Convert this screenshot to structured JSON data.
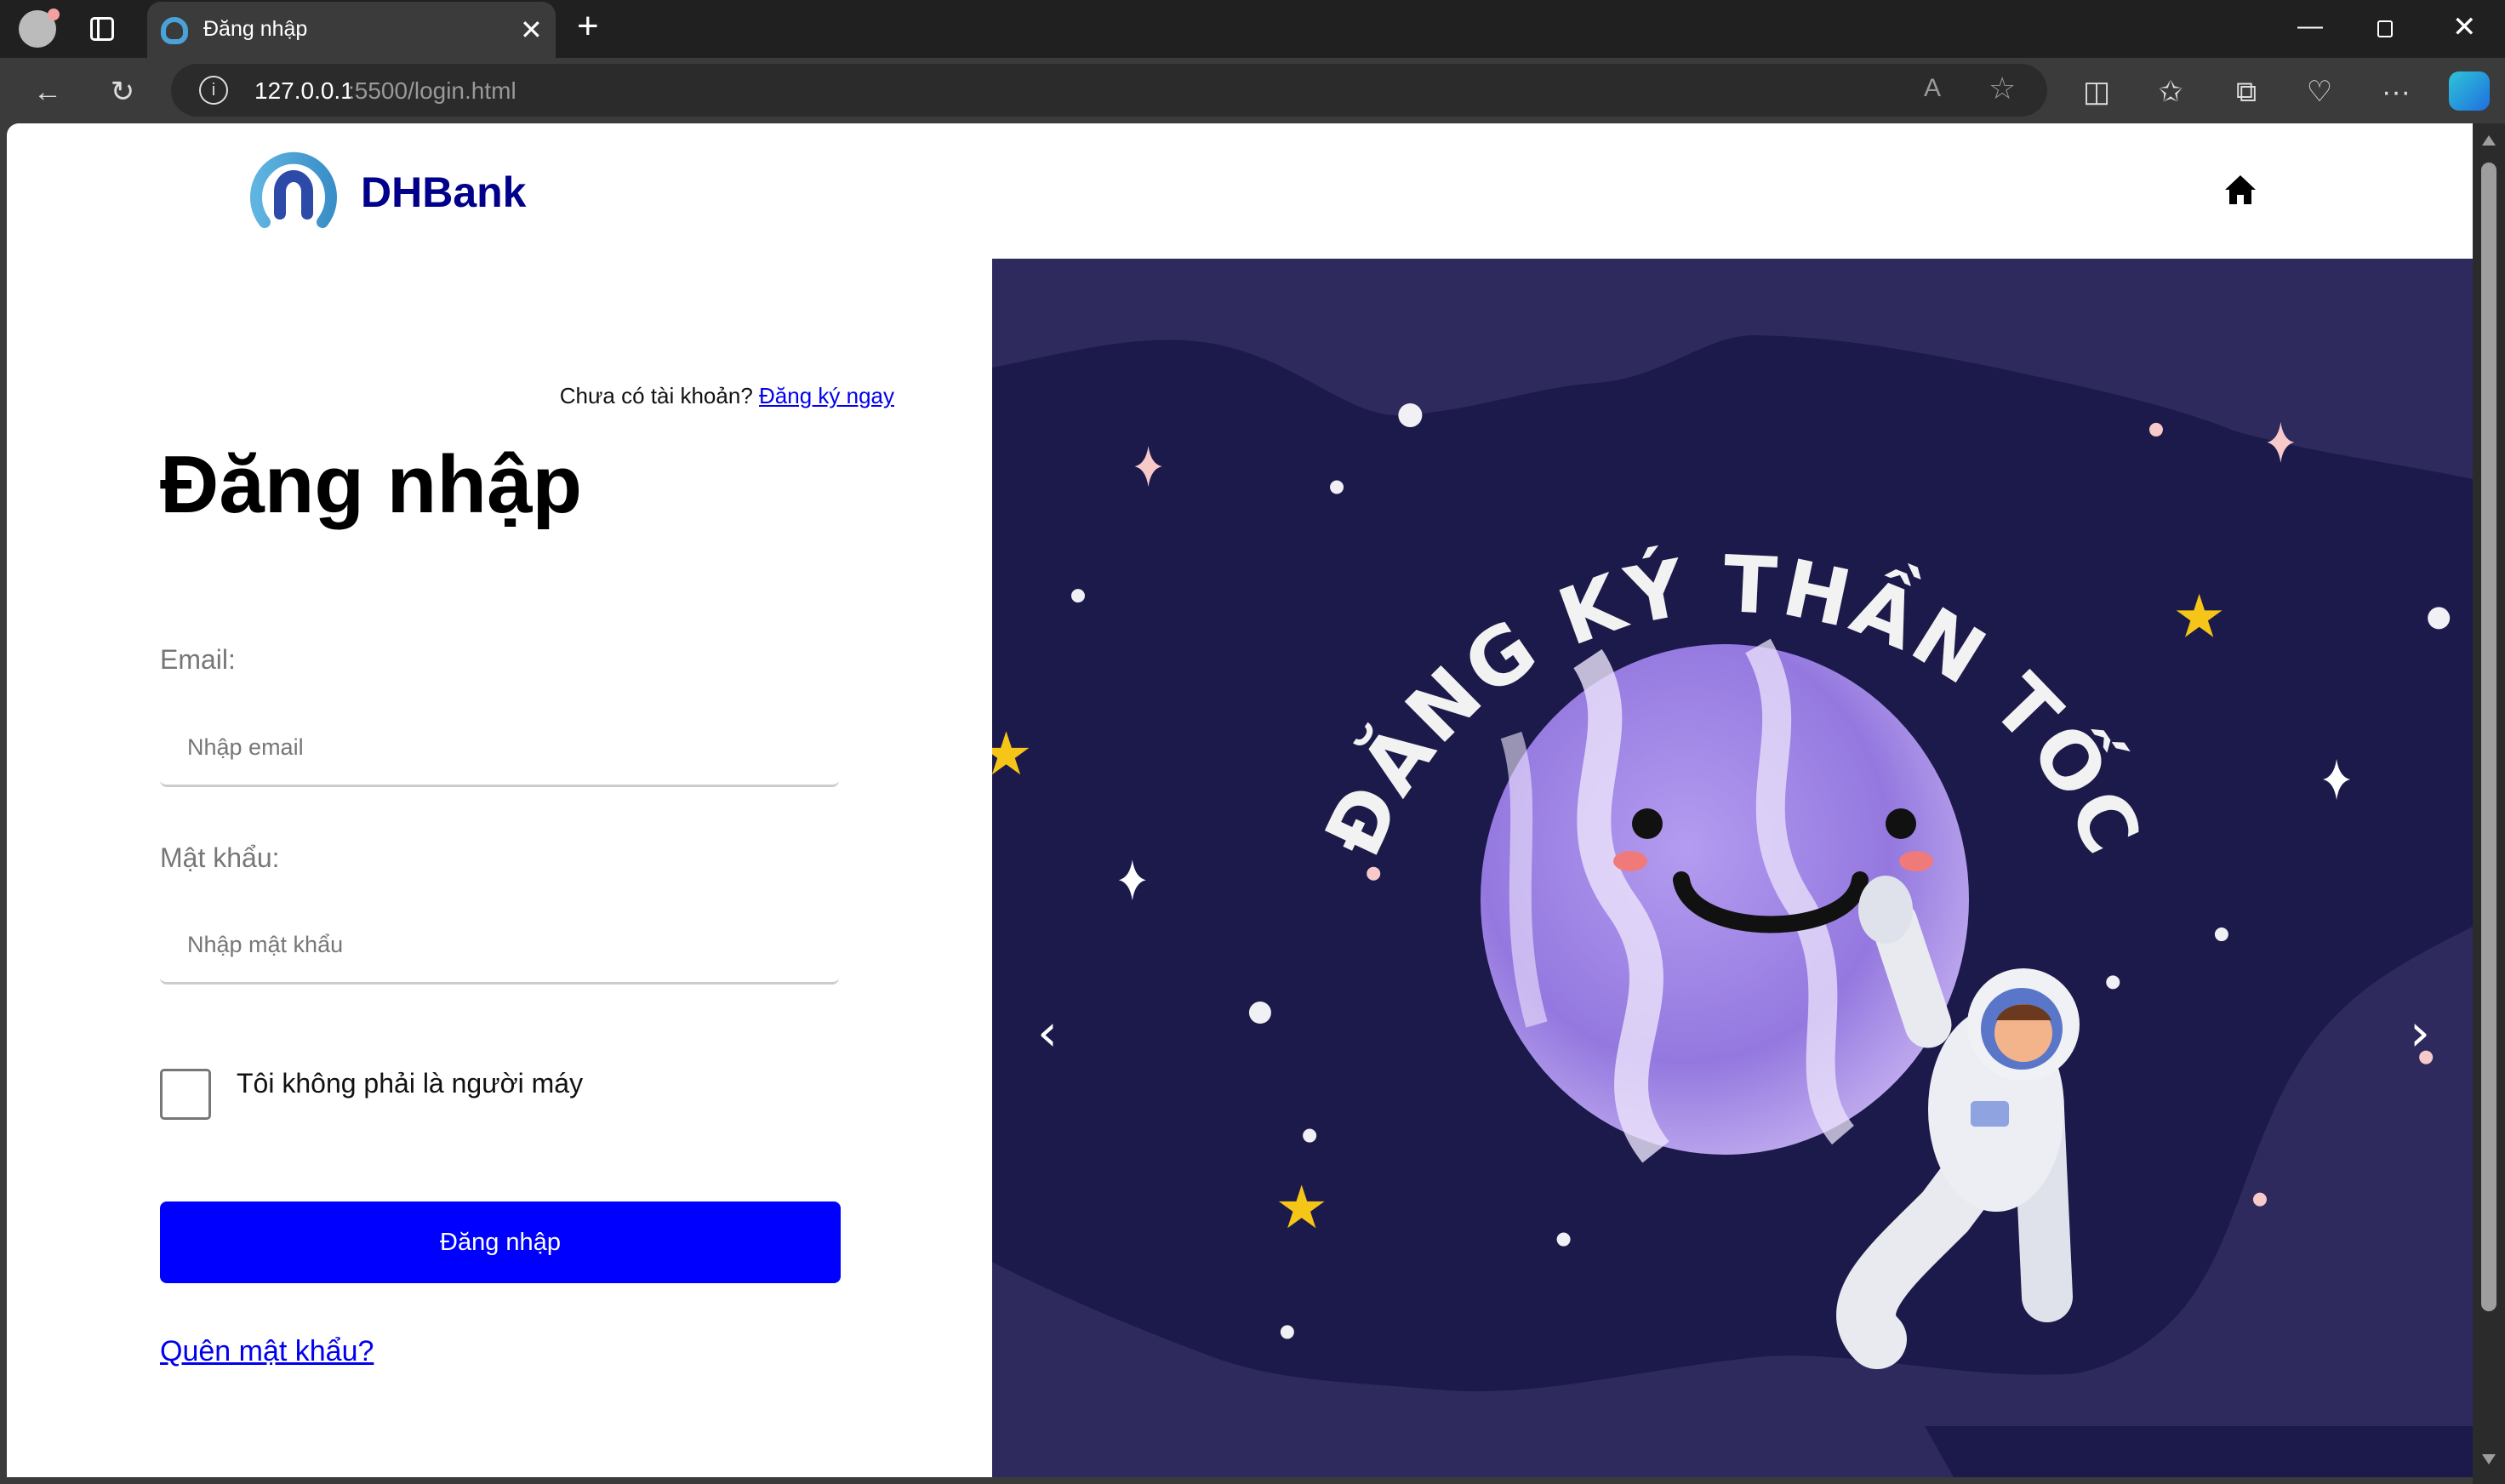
{
  "browser": {
    "tab_title": "Đăng nhập",
    "url_host": "127.0.0.1",
    "url_rest": ":5500/login.html"
  },
  "header": {
    "brand": "DHBank"
  },
  "login": {
    "signup_prompt": "Chưa có tài khoản?",
    "signup_link": "Đăng ký ngay",
    "title": "Đăng nhập",
    "email_label": "Email:",
    "email_placeholder": "Nhập email",
    "email_value": "",
    "password_label": "Mật khẩu:",
    "password_placeholder": "Nhập mật khẩu",
    "password_value": "",
    "captcha_label": "Tôi không phải là người máy",
    "captcha_checked": false,
    "submit_label": "Đăng nhập",
    "forgot_link": "Quên mật khẩu?"
  },
  "banner": {
    "headline": "ĐĂNG KÝ THẦN TỐC",
    "prev_label": "‹",
    "next_label": "›"
  },
  "colors": {
    "brand": "#00008b",
    "button": "#0000ff",
    "link": "#0000ee",
    "banner_bg": "#2e2a5e",
    "banner_inner": "#1c1a4a"
  }
}
